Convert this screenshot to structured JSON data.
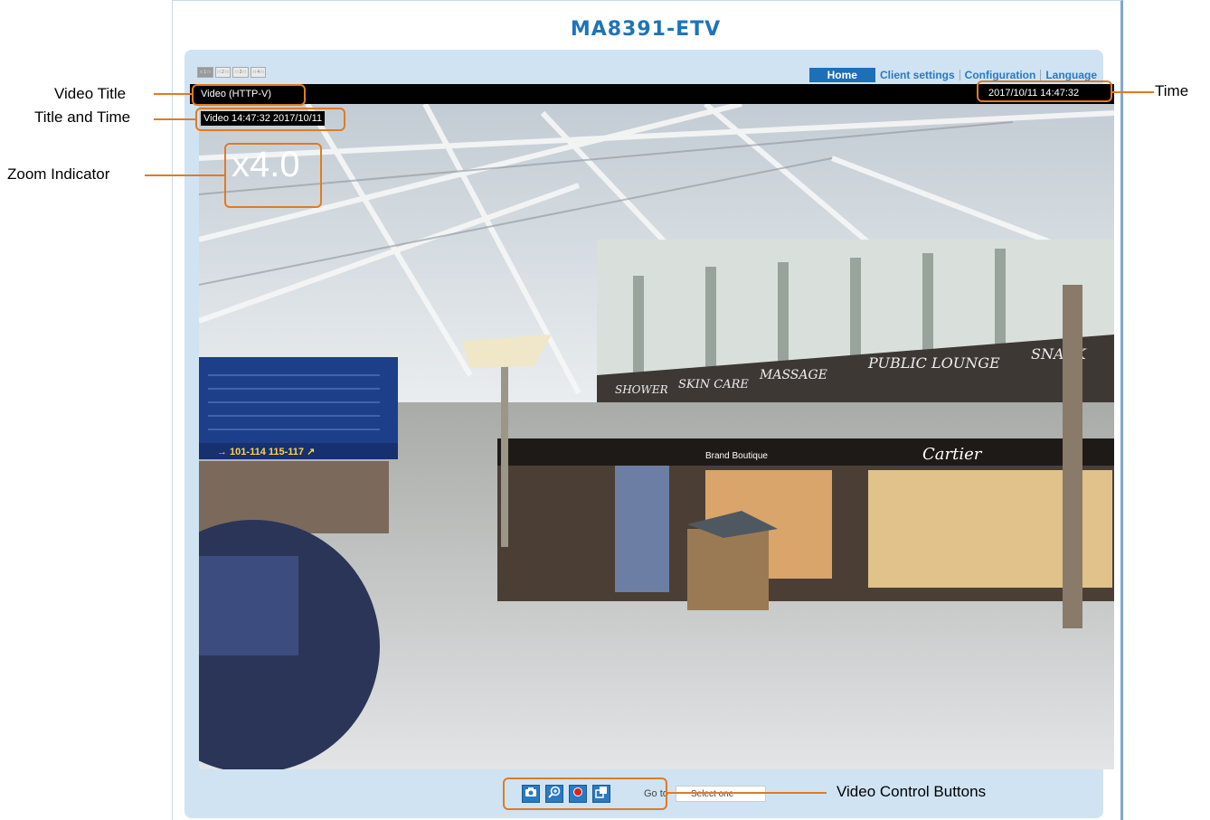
{
  "app": {
    "title": "MA8391-ETV"
  },
  "stream_tabs": [
    "□ 1 □",
    "□ 2 □",
    "□ 3 □",
    "□ 4 □"
  ],
  "nav": {
    "home": "Home",
    "client_settings": "Client settings",
    "configuration": "Configuration",
    "language": "Language"
  },
  "video": {
    "title": "Video (HTTP-V)",
    "time": "2017/10/11 14:47:32",
    "title_and_time": "Video 14:47:32  2017/10/11",
    "zoom": "x4.0"
  },
  "controls": {
    "buttons": [
      "snapshot-icon",
      "digital-zoom-icon",
      "record-icon",
      "fullscreen-icon"
    ],
    "goto_label": "Go to",
    "goto_select": "Select one"
  },
  "callouts": {
    "video_title": "Video Title",
    "title_and_time": "Title and Time",
    "zoom_indicator": "Zoom Indicator",
    "time": "Time",
    "video_control_buttons": "Video Control Buttons"
  },
  "colors": {
    "accent": "#1e74b7",
    "callout": "#e07b22",
    "panel": "#cfe3f3"
  }
}
